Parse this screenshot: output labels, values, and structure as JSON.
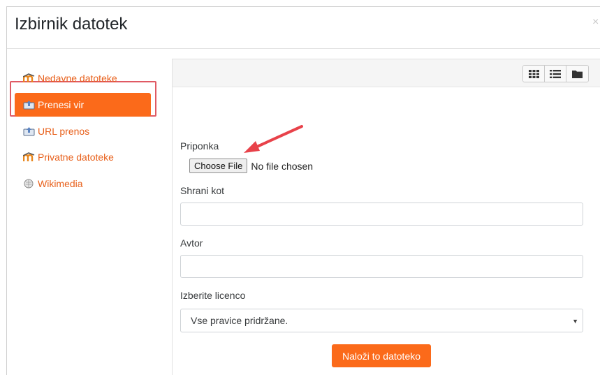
{
  "dialog": {
    "title": "Izbirnik datotek",
    "close_glyph": "×"
  },
  "sidebar": {
    "items": [
      {
        "label": "Nedavne datoteke",
        "icon": "moodle-icon"
      },
      {
        "label": "Prenesi vir",
        "icon": "upload-icon",
        "active": true
      },
      {
        "label": "URL prenos",
        "icon": "url-download-icon"
      },
      {
        "label": "Privatne datoteke",
        "icon": "moodle-icon"
      },
      {
        "label": "Wikimedia",
        "icon": "wikimedia-icon"
      }
    ]
  },
  "toolbar": {
    "views": [
      "grid-view-icon",
      "list-view-icon",
      "folder-view-icon"
    ]
  },
  "form": {
    "attachment_label": "Priponka",
    "choose_file_label": "Choose File",
    "no_file_text": "No file chosen",
    "save_as_label": "Shrani kot",
    "save_as_value": "",
    "author_label": "Avtor",
    "author_value": "",
    "license_label": "Izberite licenco",
    "license_value": "Vse pravice pridržane.",
    "upload_button": "Naloži to datoteko"
  },
  "colors": {
    "accent": "#fb6a1a",
    "link": "#e8601b",
    "highlight": "#e05a64",
    "arrow": "#e8424a"
  }
}
